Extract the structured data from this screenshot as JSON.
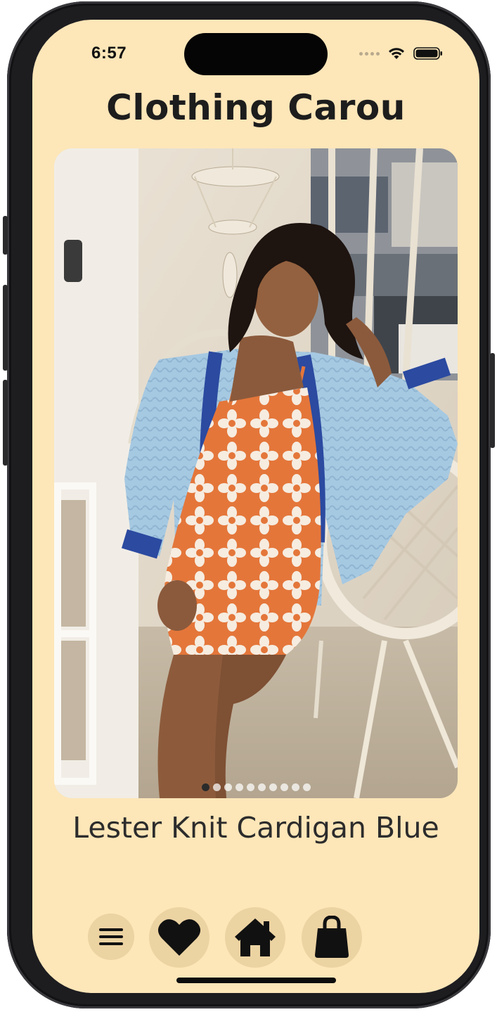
{
  "status_bar": {
    "time": "6:57",
    "icons": [
      "signal-dots",
      "wifi-icon",
      "battery-icon"
    ]
  },
  "header": {
    "title": "Clothing Carou"
  },
  "carousel": {
    "image_alt": "Lester Knit Cardigan Blue",
    "page_count": 10,
    "current_page": 1
  },
  "product": {
    "name": "Lester Knit Cardigan Blue"
  },
  "tab_bar": {
    "items": [
      {
        "icon": "menu-icon"
      },
      {
        "icon": "heart-icon"
      },
      {
        "icon": "home-icon"
      },
      {
        "icon": "shopping-bag-icon"
      }
    ]
  },
  "colors": {
    "background": "#fde6b8",
    "tab_circle": "#ecd3a2",
    "text": "#1d1d1d"
  }
}
